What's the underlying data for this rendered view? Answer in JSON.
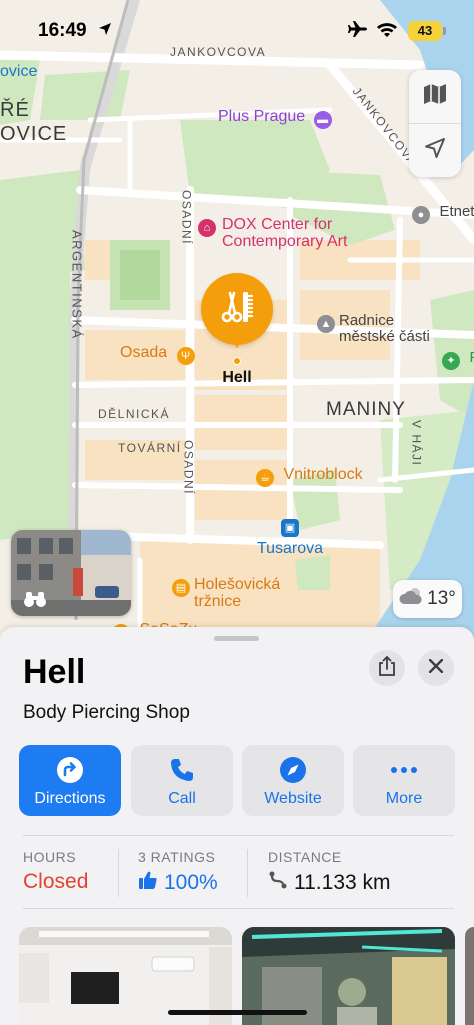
{
  "status_bar": {
    "time": "16:49",
    "battery": "43",
    "icons": [
      "location-arrow-icon",
      "airplane-icon",
      "wifi-icon",
      "battery-icon"
    ]
  },
  "map": {
    "streets": [
      "JANKOVCOVA",
      "JANKOVCOVA",
      "ARGENTINSKÁ",
      "OSADNÍ",
      "OSADNÍ",
      "DĚLNICKÁ",
      "TOVÁRNÍ",
      "V HÁJI"
    ],
    "district_labels": [
      "ŘÉ",
      "OVICE",
      "MANINY"
    ],
    "pois": {
      "plus_prague": "Plus Prague",
      "dox": "DOX Center for\nContemporary Art",
      "etnet": "Etnet",
      "radnice": "Radnice\nměstské části",
      "osada": "Osada",
      "vnitroblock": "Vnitroblock",
      "tusarova": "Tusarova",
      "holesovicka": "Holešovická\ntržnice",
      "partial_top_left": "ovice",
      "partial_bottom": "SaSaZu",
      "partial_right": "P"
    },
    "selected_pin": {
      "label": "Hell",
      "icon": "scissors-comb-icon"
    },
    "weather": {
      "temperature": "13°",
      "icon": "partly-cloudy-icon"
    },
    "controls": [
      "map-mode-icon",
      "location-arrow-icon"
    ]
  },
  "sheet": {
    "name": "Hell",
    "category": "Body Piercing Shop",
    "actions": [
      {
        "label": "Directions",
        "icon": "directions-icon"
      },
      {
        "label": "Call",
        "icon": "phone-icon"
      },
      {
        "label": "Website",
        "icon": "compass-icon"
      },
      {
        "label": "More",
        "icon": "ellipsis-icon"
      }
    ],
    "info": {
      "hours_header": "HOURS",
      "hours_value": "Closed",
      "ratings_header": "3 RATINGS",
      "ratings_value": "100%",
      "distance_header": "DISTANCE",
      "distance_value": "11.133 km"
    }
  },
  "colors": {
    "accent": "#1e7cf2",
    "pin": "#f59e0b",
    "closed": "#e0452f",
    "rating": "#1a73e8"
  }
}
